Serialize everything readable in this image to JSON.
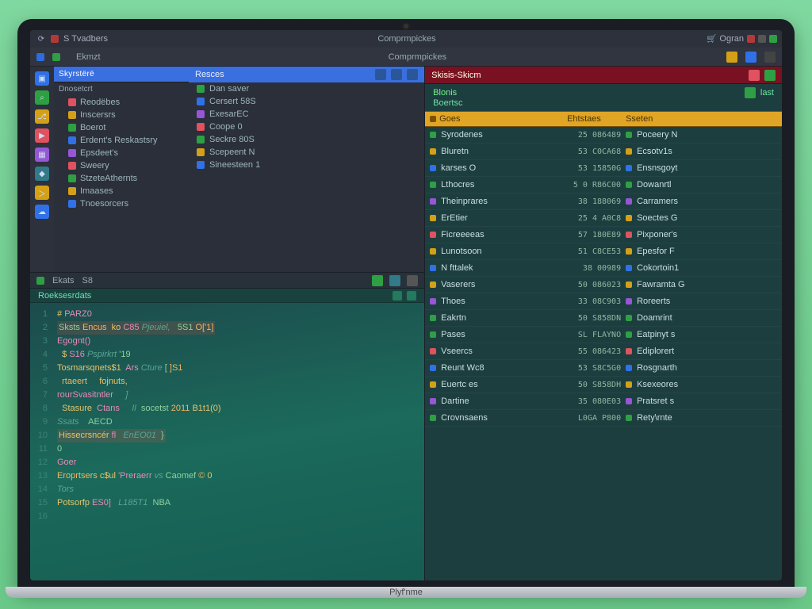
{
  "titlebar": {
    "left_label": "S Tvadbers",
    "center_label": "Comprmpickes",
    "right_label": "Ogran"
  },
  "tabstrip": {
    "left_tab": "Ekmzt",
    "center_tab": "Comprmpickes"
  },
  "explorer": {
    "header": "Skyrstërë",
    "section": "Dnosetcrt",
    "items": [
      "Reodëbes",
      "Inscersrs",
      "Boerot",
      "Erdent's Reskastsry",
      "Epsdeet's",
      "Sweery",
      "StzeteAthernts",
      "Imaases",
      "Tnoesorcers"
    ]
  },
  "modules": {
    "header": "Resces",
    "items": [
      "Dan saver",
      "Cersert 58S",
      "ExesarEC",
      "Coope 0",
      "Seckre 80S",
      "Scepeent N",
      "Sineesteen 1"
    ]
  },
  "editor": {
    "tab_a": "Ekats",
    "tab_b": "S8",
    "filename": "Roeksesrdats",
    "gutter": [
      "1",
      "2",
      "3",
      "4",
      "5",
      "6",
      "7",
      "8",
      "9",
      "10",
      "11",
      "12",
      "13",
      "14",
      "15",
      "16"
    ],
    "lines": [
      {
        "txt": "# PARZ0"
      },
      {
        "txt": "Sksts Encus  ko C85 Pjeuiel,   5S1 O['1]"
      },
      {
        "txt": "Egognt()"
      },
      {
        "txt": "  $ S16 Pspirkrt '19"
      },
      {
        "txt": ""
      },
      {
        "txt": "Tosmarsqnets$1  Ars Cture [ ]S1"
      },
      {
        "txt": "  rtaeert     fojnuts,"
      },
      {
        "txt": "rourSvasitntler     ]"
      },
      {
        "txt": "  Stasure  Ctans     Il  socetst 2011 B1t1(0)"
      },
      {
        "txt": "Ssats    AECD"
      },
      {
        "txt": "Hissecrsncér fl   EnEO01  }"
      },
      {
        "txt": "0"
      },
      {
        "txt": "Goer"
      },
      {
        "txt": "Eroprtsers c$ul 'Preraerr vs Caomef © 0"
      },
      {
        "txt": "Tors"
      },
      {
        "txt": "Potsorfp ES0]   L185T1  NBA"
      }
    ]
  },
  "propPanel": {
    "title": "Skisis-Skicm",
    "line1": "Blonis",
    "line2": "Boertsc",
    "last_label": "last",
    "cols": {
      "c1": "Goes",
      "c2": "Ehtstaes",
      "c3": "Sseten"
    },
    "rows": [
      {
        "n": "Syrodenes",
        "v": "25 086489",
        "t": "Poceery N",
        "c": "#2ea043",
        "b": "#3071e8"
      },
      {
        "n": "Bluretn",
        "v": "53 C0CA68",
        "t": "Ecsotv1s",
        "c": "#d4a017",
        "b": "#9656d6"
      },
      {
        "n": "karses O",
        "v": "53 15850G",
        "t": "Ensnsgoyt",
        "c": "#3071e8",
        "b": "#e05260"
      },
      {
        "n": "Lthocres",
        "v": "5 0 R86C00",
        "t": "Dowanrtl",
        "c": "#2ea043",
        "b": "#327a8a"
      },
      {
        "n": "Theinprares",
        "v": "38 188069",
        "t": "Carramers",
        "c": "#9656d6",
        "b": "#2ea043"
      },
      {
        "n": "ErEtier",
        "v": "25 4 A0C8",
        "t": "Soectes G",
        "c": "#d4a017",
        "b": "#2ea043"
      },
      {
        "n": "Ficreeeeas",
        "v": "57 180E89",
        "t": "Pixponer's",
        "c": "#e05260",
        "b": "#e05260"
      },
      {
        "n": "Lunotsoon",
        "v": "51 C8CE53",
        "t": "Epesfor F",
        "c": "#d4a017",
        "b": "#327a8a"
      },
      {
        "n": "N fttalek",
        "v": "38 00989",
        "t": "Cokortoin1",
        "c": "#3071e8",
        "b": "#d4a017"
      },
      {
        "n": "Vaserers",
        "v": "50 086023",
        "t": "Fawramta G",
        "c": "#d4a017",
        "b": "#2ea043"
      },
      {
        "n": "Thoes",
        "v": "33 08C903",
        "t": "Roreerts",
        "c": "#9656d6",
        "b": "#3071e8"
      },
      {
        "n": "Eakrtn",
        "v": "50 S858DN",
        "t": "Doamrint",
        "c": "#2ea043",
        "b": "#d4a017"
      },
      {
        "n": "Pases",
        "v": "SL FLAYNO",
        "t": "Eatpinyt s",
        "c": "#2ea043",
        "b": "#3071e8"
      },
      {
        "n": "Vseercs",
        "v": "55 086423",
        "t": "Ediplorert",
        "c": "#e05260",
        "b": "#2ea043"
      },
      {
        "n": "Reunt Wc8",
        "v": "53 S8C5G0",
        "t": "Rosgnarth",
        "c": "#3071e8",
        "b": "#e05260"
      },
      {
        "n": "Euertc es",
        "v": "50 S858DH",
        "t": "Ksexeores",
        "c": "#d4a017",
        "b": "#327a8a"
      },
      {
        "n": "Dartine",
        "v": "35 080E03",
        "t": "Pratsret s",
        "c": "#9656d6",
        "b": "#d4a017"
      },
      {
        "n": "Crovnsaens",
        "v": "L0GA P800",
        "t": "Rety\\rnte",
        "c": "#2ea043",
        "b": "#d4a017"
      }
    ]
  },
  "brand": "Plyf'nme"
}
